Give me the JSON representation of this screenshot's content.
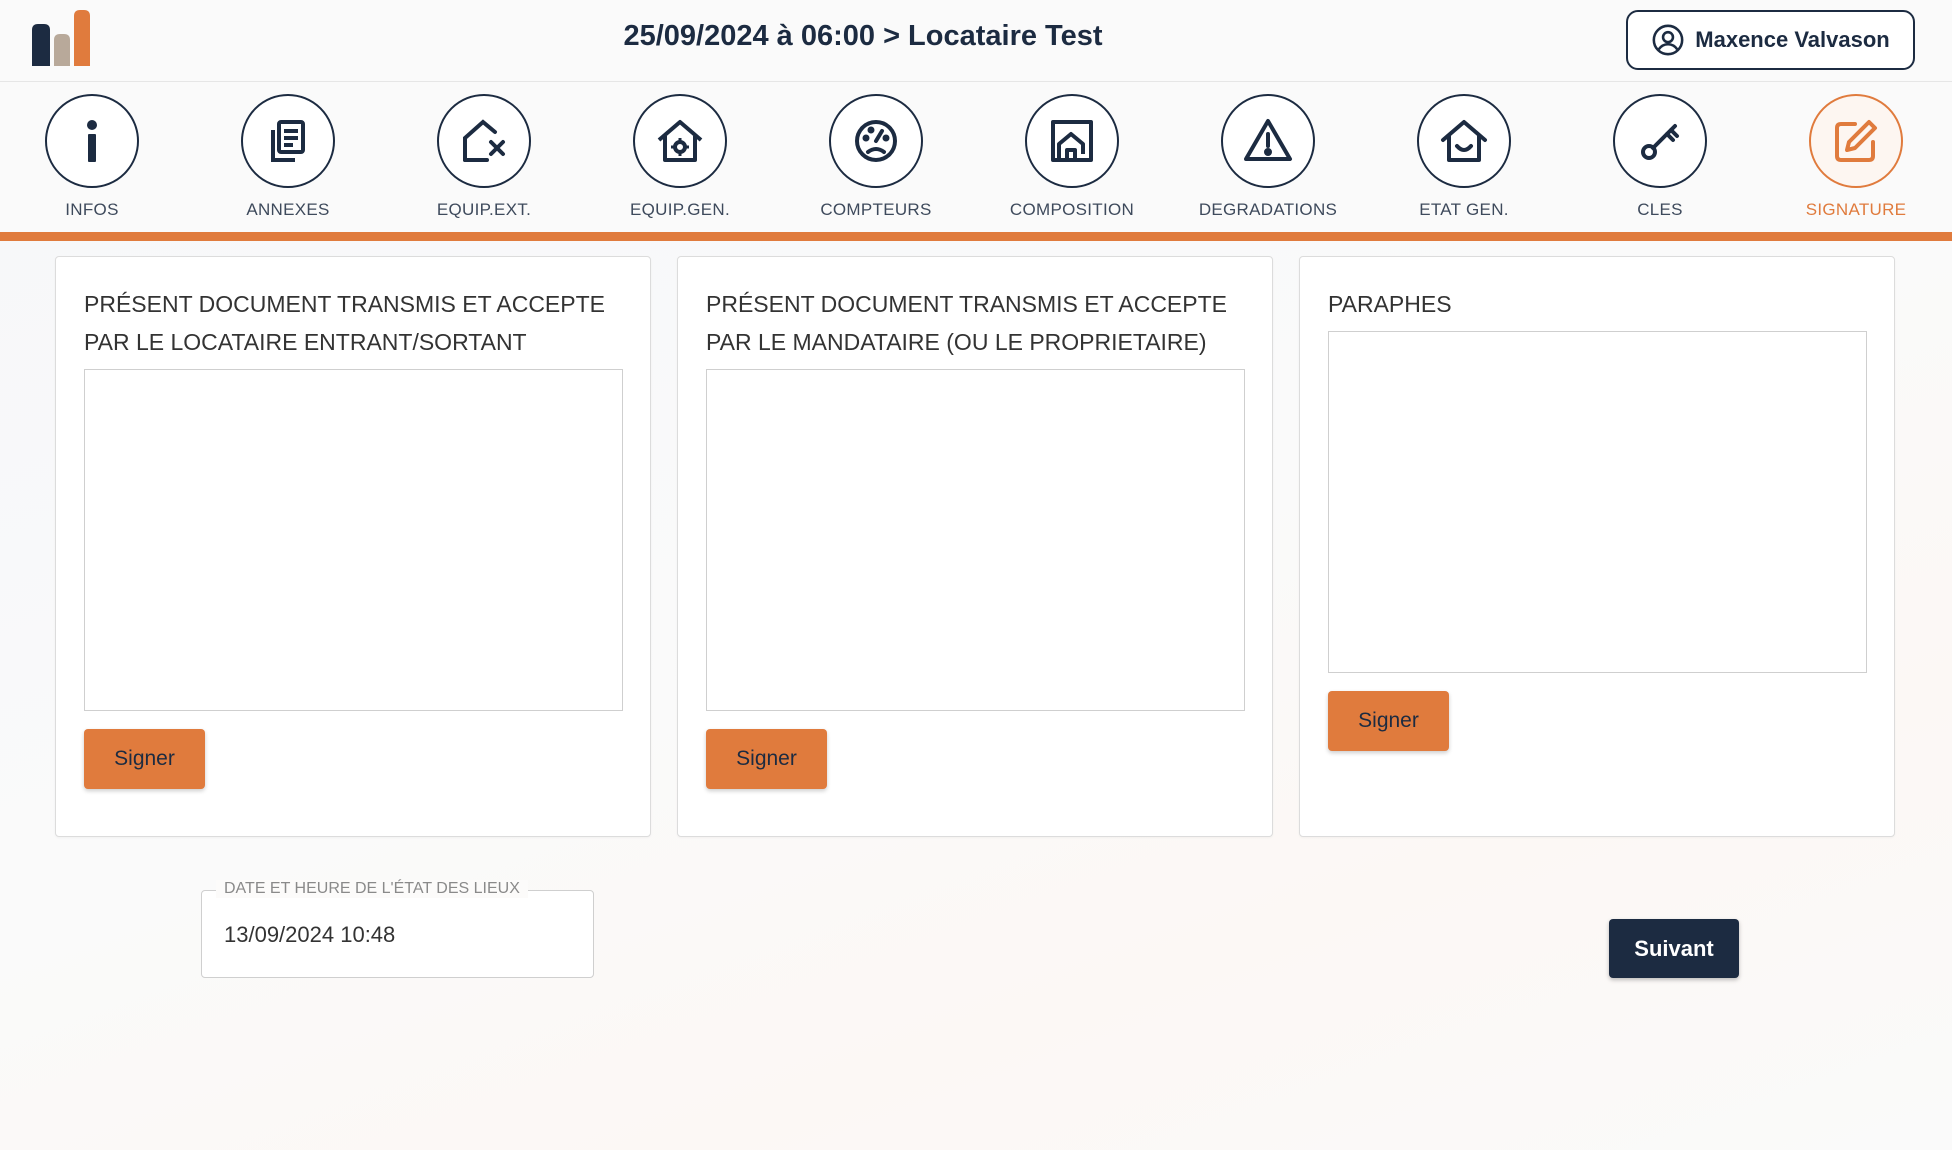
{
  "header": {
    "title": "25/09/2024 à 06:00 > Locataire Test",
    "user_name": "Maxence Valvason",
    "user_icon": "user-circle-icon",
    "logo_colors": [
      "#1c2b41",
      "#b8a99a",
      "#e07b3d"
    ]
  },
  "tabs": [
    {
      "label": "INFOS",
      "icon": "info-icon"
    },
    {
      "label": "ANNEXES",
      "icon": "documents-icon"
    },
    {
      "label": "EQUIP.EXT.",
      "icon": "house-x-icon"
    },
    {
      "label": "EQUIP.GEN.",
      "icon": "house-gear-icon"
    },
    {
      "label": "COMPTEURS",
      "icon": "gauge-icon"
    },
    {
      "label": "COMPOSITION",
      "icon": "floorplan-icon"
    },
    {
      "label": "DEGRADATIONS",
      "icon": "warning-icon"
    },
    {
      "label": "ETAT GEN.",
      "icon": "house-smile-icon"
    },
    {
      "label": "CLES",
      "icon": "key-icon"
    },
    {
      "label": "SIGNATURE",
      "icon": "edit-icon",
      "active": true
    }
  ],
  "cards": [
    {
      "title": "PRÉSENT DOCUMENT TRANSMIS ET ACCEPTE PAR LE LOCATAIRE ENTRANT/SORTANT",
      "button": "Signer"
    },
    {
      "title": "PRÉSENT DOCUMENT TRANSMIS ET ACCEPTE PAR LE MANDATAIRE (OU LE PROPRIETAIRE)",
      "button": "Signer"
    },
    {
      "title": "PARAPHES",
      "button": "Signer"
    }
  ],
  "date_field": {
    "label": "DATE ET HEURE DE L'ÉTAT DES LIEUX",
    "value": "13/09/2024 10:48"
  },
  "next_button": "Suivant",
  "colors": {
    "accent": "#e07b3d",
    "navy": "#1c2b41"
  }
}
